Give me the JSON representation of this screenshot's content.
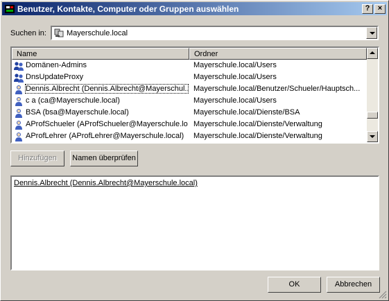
{
  "window": {
    "title": "Benutzer, Kontakte, Computer oder Gruppen auswählen",
    "help_label": "?",
    "close_label": "×"
  },
  "look_in": {
    "label": "Suchen in:",
    "value": "Mayerschule.local"
  },
  "list": {
    "columns": [
      "Name",
      "Ordner"
    ],
    "rows": [
      {
        "name": "Domänen-Admins",
        "folder": "Mayerschule.local/Users",
        "icon": "group-icon"
      },
      {
        "name": "DnsUpdateProxy",
        "folder": "Mayerschule.local/Users",
        "icon": "group-icon"
      },
      {
        "name": "Dennis.Albrecht (Dennis.Albrecht@Mayerschul...",
        "folder": "Mayerschule.local/Benutzer/Schueler/Hauptsch...",
        "icon": "user-icon"
      },
      {
        "name": "c a (ca@Mayerschule.local)",
        "folder": "Mayerschule.local/Users",
        "icon": "user-icon"
      },
      {
        "name": "BSA (bsa@Mayerschule.local)",
        "folder": "Mayerschule.local/Dienste/BSA",
        "icon": "user-icon"
      },
      {
        "name": "AProfSchueler (AProfSchueler@Mayerschule.lo...",
        "folder": "Mayerschule.local/Dienste/Verwaltung",
        "icon": "user-icon"
      },
      {
        "name": "AProfLehrer (AProfLehrer@Mayerschule.local)",
        "folder": "Mayerschule.local/Dienste/Verwaltung",
        "icon": "user-icon"
      }
    ]
  },
  "buttons": {
    "add": "Hinzufügen",
    "check_names": "Namen überprüfen",
    "ok": "OK",
    "cancel": "Abbrechen"
  },
  "selected_names": [
    "Dennis.Albrecht (Dennis.Albrecht@Mayerschule.local)"
  ],
  "colors": {
    "titlebar_start": "#0a246a",
    "titlebar_end": "#a6caf0",
    "face": "#d4d0c8"
  }
}
